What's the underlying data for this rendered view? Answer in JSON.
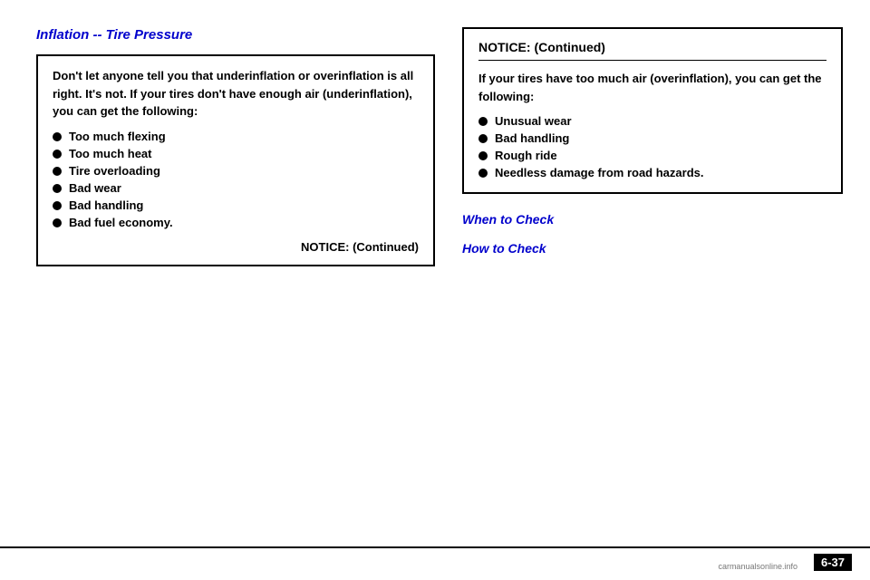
{
  "page": {
    "title": "Inflation -- Tire Pressure",
    "page_number": "6-37"
  },
  "left_column": {
    "body_text_1": "",
    "notice_box": {
      "header": "Don't let anyone tell you that underinflation or overinflation is all right. It's not. If your tires don't have enough air (underinflation), you can get the following:",
      "bullet_items": [
        "Too much flexing",
        "Too much heat",
        "Tire overloading",
        "Bad wear",
        "Bad handling",
        "Bad fuel economy."
      ],
      "continued_label": "NOTICE: (Continued)"
    }
  },
  "right_column": {
    "notice_continued_box": {
      "header": "NOTICE: (Continued)",
      "intro_text": "If your tires have too much air (overinflation), you can get the following:",
      "bullet_items": [
        "Unusual wear",
        "Bad handling",
        "Rough ride",
        "Needless damage from road hazards."
      ]
    },
    "when_to_check": {
      "heading": "When to Check",
      "text": ""
    },
    "how_to_check": {
      "heading": "How to Check",
      "text": ""
    }
  },
  "bottom": {
    "page_number": "6-37",
    "site_label": "carmanualsonline.info"
  }
}
